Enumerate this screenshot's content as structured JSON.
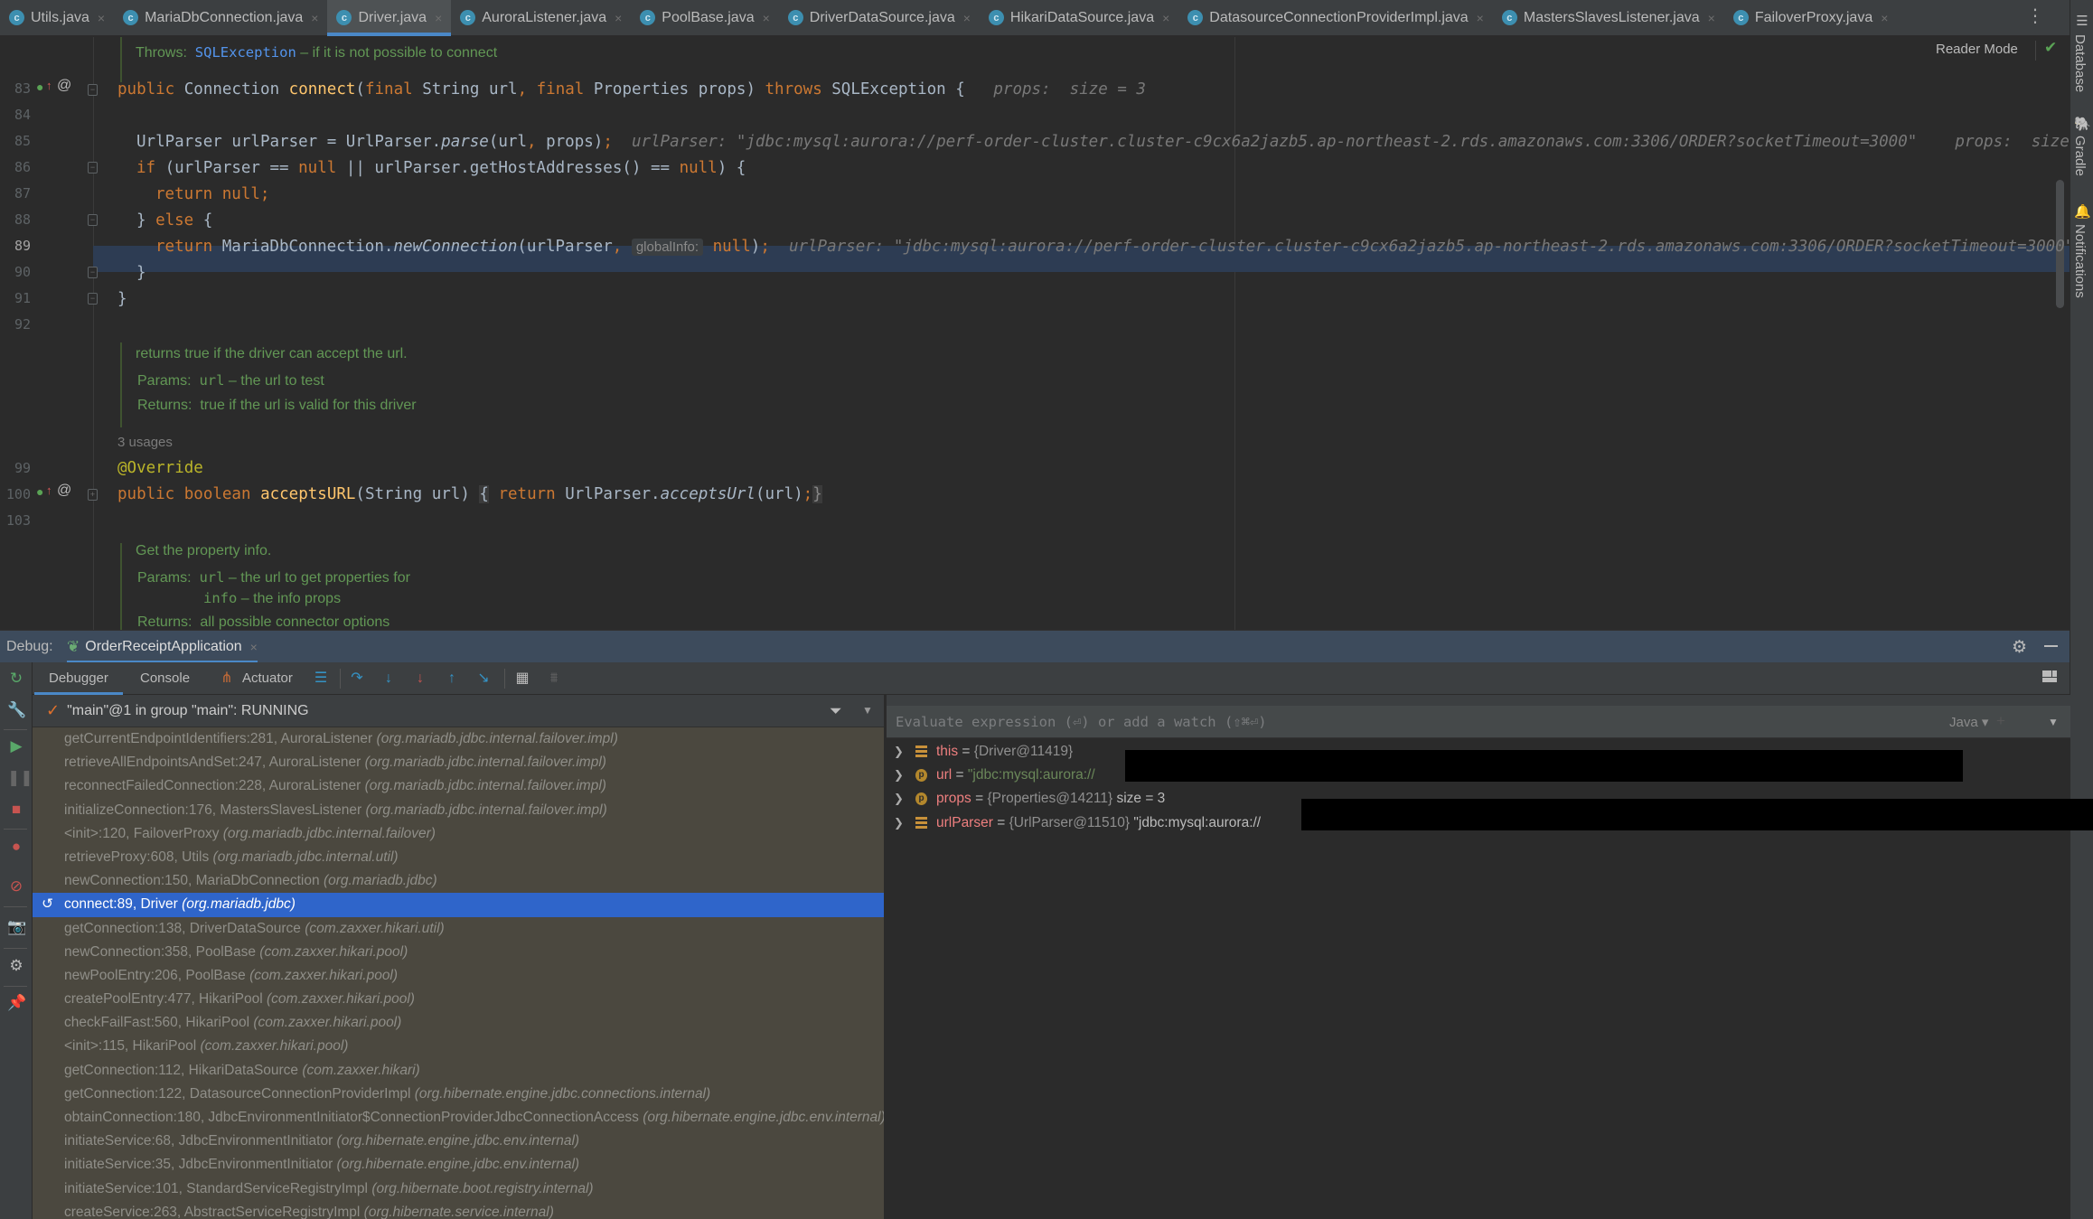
{
  "tabs": [
    {
      "label": "Utils.java",
      "active": false
    },
    {
      "label": "MariaDbConnection.java",
      "active": false
    },
    {
      "label": "Driver.java",
      "active": true
    },
    {
      "label": "AuroraListener.java",
      "active": false
    },
    {
      "label": "PoolBase.java",
      "active": false
    },
    {
      "label": "DriverDataSource.java",
      "active": false
    },
    {
      "label": "HikariDataSource.java",
      "active": false
    },
    {
      "label": "DatasourceConnectionProviderImpl.java",
      "active": false
    },
    {
      "label": "MastersSlavesListener.java",
      "active": false
    },
    {
      "label": "FailoverProxy.java",
      "active": false
    }
  ],
  "tab_close_glyph": "×",
  "tab_class_glyph": "c",
  "right_strip": {
    "database": "Database",
    "gradle": "Gradle",
    "notifications": "Notifications"
  },
  "editor": {
    "reader_mode": "Reader Mode",
    "doc1": {
      "throws_label": "Throws:",
      "throws_type": "SQLException",
      "throws_text": "– if it is not possible to connect"
    },
    "line_numbers": {
      "l83": "83",
      "l84": "84",
      "l85": "85",
      "l86": "86",
      "l87": "87",
      "l88": "88",
      "l89": "89",
      "l90": "90",
      "l91": "91",
      "l92": "92",
      "l99": "99",
      "l100": "100",
      "l103": "103"
    },
    "code": {
      "l83": {
        "kw1": "public",
        "t1": " Connection ",
        "fn": "connect",
        "t2": "(",
        "kw2": "final",
        "t3": " String url",
        "c1": ",",
        "kw3": " final",
        "t4": " Properties props) ",
        "kw4": "throws",
        "t5": " SQLException {",
        "hint": "props:  size = 3"
      },
      "l85": {
        "t1": "UrlParser urlParser = UrlParser.",
        "it": "parse",
        "t2": "(url",
        "c1": ",",
        "t3": " props)",
        "semi": ";",
        "hint": "urlParser: \"jdbc:mysql:aurora://perf-order-cluster.cluster-c9cx6a2jazb5.ap-northeast-2.rds.amazonaws.com:3306/ORDER?socketTimeout=3000\"    props:  size"
      },
      "l86": {
        "kw1": "if",
        "t1": " (urlParser == ",
        "kw2": "null",
        "t2": " || urlParser.getHostAddresses() == ",
        "kw3": "null",
        "t3": ") {"
      },
      "l87": {
        "kw": "return null",
        "semi": ";"
      },
      "l88": {
        "t1": "} ",
        "kw": "else",
        "t2": " {"
      },
      "l89": {
        "kw": "return",
        "t1": " MariaDbConnection.",
        "it": "newConnection",
        "t2": "(urlParser",
        "c1": ",",
        "inlay": "globalInfo:",
        "kw2": "null",
        "t3": ")",
        "semi": ";",
        "hint": "urlParser: \"jdbc:mysql:aurora://perf-order-cluster.cluster-c9cx6a2jazb5.ap-northeast-2.rds.amazonaws.com:3306/ORDER?socketTimeout=3000\""
      },
      "l90": "}",
      "l91": "}",
      "l99": "@Override",
      "l100": {
        "kw1": "public boolean",
        "fn": "acceptsURL",
        "t1": "(String url) ",
        "fold1": "{",
        "kw2": "return",
        "t2": " UrlParser.",
        "it": "acceptsUrl",
        "t3": "(url)",
        "semi": ";",
        "fold2": "}"
      }
    },
    "doc2": {
      "summary": "returns true if the driver can accept the url.",
      "params_label": "Params:",
      "param1_name": "url",
      "param1_text": "– the url to test",
      "returns_label": "Returns:",
      "returns_text": "true if the url is valid for this driver"
    },
    "usages": "3 usages",
    "doc3": {
      "summary": "Get the property info.",
      "params_label": "Params:",
      "param1_name": "url",
      "param1_text": "– the url to get properties for",
      "param2_name": "info",
      "param2_text": "– the info props",
      "returns_label": "Returns:",
      "returns_text": "all possible connector options"
    }
  },
  "debug": {
    "label": "Debug:",
    "session": "OrderReceiptApplication",
    "tabs": {
      "debugger": "Debugger",
      "console": "Console",
      "actuator": "Actuator"
    },
    "thread": "\"main\"@1 in group \"main\": RUNNING",
    "frames": [
      {
        "method": "getCurrentEndpointIdentifiers:281, AuroraListener",
        "pkg": "(org.mariadb.jdbc.internal.failover.impl)",
        "selected": false
      },
      {
        "method": "retrieveAllEndpointsAndSet:247, AuroraListener",
        "pkg": "(org.mariadb.jdbc.internal.failover.impl)",
        "selected": false
      },
      {
        "method": "reconnectFailedConnection:228, AuroraListener",
        "pkg": "(org.mariadb.jdbc.internal.failover.impl)",
        "selected": false
      },
      {
        "method": "initializeConnection:176, MastersSlavesListener",
        "pkg": "(org.mariadb.jdbc.internal.failover.impl)",
        "selected": false
      },
      {
        "method": "<init>:120, FailoverProxy",
        "pkg": "(org.mariadb.jdbc.internal.failover)",
        "selected": false
      },
      {
        "method": "retrieveProxy:608, Utils",
        "pkg": "(org.mariadb.jdbc.internal.util)",
        "selected": false
      },
      {
        "method": "newConnection:150, MariaDbConnection",
        "pkg": "(org.mariadb.jdbc)",
        "selected": false
      },
      {
        "method": "connect:89, Driver",
        "pkg": "(org.mariadb.jdbc)",
        "selected": true
      },
      {
        "method": "getConnection:138, DriverDataSource",
        "pkg": "(com.zaxxer.hikari.util)",
        "selected": false
      },
      {
        "method": "newConnection:358, PoolBase",
        "pkg": "(com.zaxxer.hikari.pool)",
        "selected": false
      },
      {
        "method": "newPoolEntry:206, PoolBase",
        "pkg": "(com.zaxxer.hikari.pool)",
        "selected": false
      },
      {
        "method": "createPoolEntry:477, HikariPool",
        "pkg": "(com.zaxxer.hikari.pool)",
        "selected": false
      },
      {
        "method": "checkFailFast:560, HikariPool",
        "pkg": "(com.zaxxer.hikari.pool)",
        "selected": false
      },
      {
        "method": "<init>:115, HikariPool",
        "pkg": "(com.zaxxer.hikari.pool)",
        "selected": false
      },
      {
        "method": "getConnection:112, HikariDataSource",
        "pkg": "(com.zaxxer.hikari)",
        "selected": false
      },
      {
        "method": "getConnection:122, DatasourceConnectionProviderImpl",
        "pkg": "(org.hibernate.engine.jdbc.connections.internal)",
        "selected": false
      },
      {
        "method": "obtainConnection:180, JdbcEnvironmentInitiator$ConnectionProviderJdbcConnectionAccess",
        "pkg": "(org.hibernate.engine.jdbc.env.internal)",
        "selected": false
      },
      {
        "method": "initiateService:68, JdbcEnvironmentInitiator",
        "pkg": "(org.hibernate.engine.jdbc.env.internal)",
        "selected": false
      },
      {
        "method": "initiateService:35, JdbcEnvironmentInitiator",
        "pkg": "(org.hibernate.engine.jdbc.env.internal)",
        "selected": false
      },
      {
        "method": "initiateService:101, StandardServiceRegistryImpl",
        "pkg": "(org.hibernate.boot.registry.internal)",
        "selected": false
      },
      {
        "method": "createService:263, AbstractServiceRegistryImpl",
        "pkg": "(org.hibernate.service.internal)",
        "selected": false
      }
    ],
    "eval_placeholder": "Evaluate expression (⏎) or add a watch (⇧⌘⏎)",
    "eval_language": "Java",
    "variables": [
      {
        "icon": "field",
        "name": "this",
        "eq": " = ",
        "value": "{Driver@11419}",
        "extra": "",
        "is_string": false
      },
      {
        "icon": "param",
        "name": "url",
        "eq": " = ",
        "value": "\"jdbc:mysql:aurora://",
        "extra": "",
        "is_string": true
      },
      {
        "icon": "param",
        "name": "props",
        "eq": " = ",
        "value": "{Properties@14211}",
        "extra": " size = 3",
        "is_string": false
      },
      {
        "icon": "field",
        "name": "urlParser",
        "eq": " = ",
        "value": "{UrlParser@11510}",
        "extra": " \"jdbc:mysql:aurora://",
        "is_string": false
      }
    ]
  }
}
